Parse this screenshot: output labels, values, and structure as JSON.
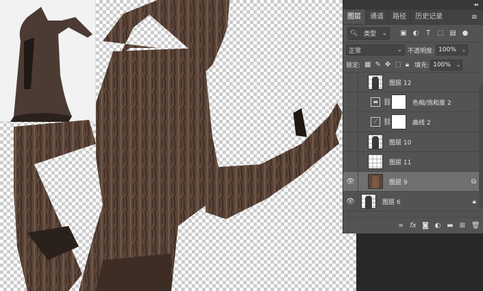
{
  "panel": {
    "tabs": [
      {
        "label": "图层"
      },
      {
        "label": "通道"
      },
      {
        "label": "路径"
      },
      {
        "label": "历史记录"
      }
    ],
    "filter_kind": "类型",
    "blend_mode": "正常",
    "opacity_label": "不透明度:",
    "opacity_value": "100%",
    "lock_label": "锁定:",
    "fill_label": "填充:",
    "fill_value": "100%"
  },
  "layers": [
    {
      "name": "图层 12",
      "visible": false,
      "type": "pixel"
    },
    {
      "name": "色相/饱和度 2",
      "visible": false,
      "type": "adjustment-hue"
    },
    {
      "name": "曲线 2",
      "visible": false,
      "type": "adjustment-curves"
    },
    {
      "name": "图层 10",
      "visible": false,
      "type": "pixel"
    },
    {
      "name": "图层 11",
      "visible": false,
      "type": "pixel"
    },
    {
      "name": "图层 9",
      "visible": true,
      "type": "smart",
      "selected": true
    },
    {
      "name": "图层 6",
      "visible": true,
      "type": "pixel",
      "locked": true
    }
  ],
  "colors": {
    "panel_bg": "#535353",
    "selected_row": "#707070",
    "bark_dark": "#3d2d25",
    "bark_mid": "#5b4538"
  }
}
